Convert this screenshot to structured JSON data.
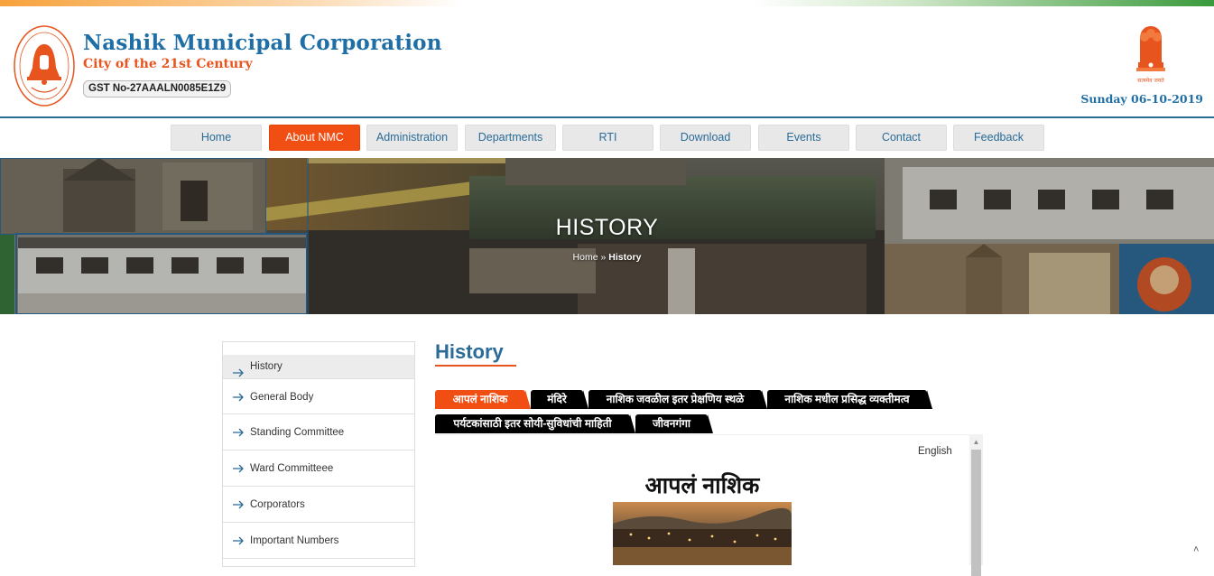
{
  "header": {
    "org_name": "Nashik Municipal Corporation",
    "tagline": "City of the 21st Century",
    "gst": "GST No-27AAALN0085E1Z9",
    "date": "Sunday 06-10-2019",
    "emblem_motto": "सत्यमेव जयते"
  },
  "nav": {
    "items": [
      {
        "label": "Home"
      },
      {
        "label": "About NMC",
        "active": true
      },
      {
        "label": "Administration"
      },
      {
        "label": "Departments"
      },
      {
        "label": "RTI"
      },
      {
        "label": "Download"
      },
      {
        "label": "Events"
      },
      {
        "label": "Contact"
      },
      {
        "label": "Feedback"
      }
    ]
  },
  "banner": {
    "title": "HISTORY",
    "breadcrumb_home": "Home",
    "breadcrumb_sep": " » ",
    "breadcrumb_current": "History"
  },
  "sidebar": {
    "items": [
      {
        "label": "History",
        "active": true
      },
      {
        "label": "General Body"
      },
      {
        "label": "Standing Committee"
      },
      {
        "label": "Ward Committeee"
      },
      {
        "label": "Corporators"
      },
      {
        "label": "Important Numbers"
      }
    ]
  },
  "main": {
    "title": "History",
    "tabs": [
      {
        "label": "आपलं नाशिक",
        "active": true
      },
      {
        "label": "मंदिरे"
      },
      {
        "label": "नाशिक जवळील इतर प्रेक्षणिय स्थळे"
      },
      {
        "label": "नाशिक मधील प्रसिद्ध व्यक्तीमत्व"
      },
      {
        "label": "पर्यटकांसाठी इतर सोयी-सुविधांची माहिती"
      },
      {
        "label": "जीवनगंगा"
      }
    ],
    "content": {
      "lang_link": "English",
      "heading": "आपलं नाशिक"
    }
  },
  "colors": {
    "brand_blue": "#1f6fa6",
    "accent_orange": "#f04e12",
    "tab_black": "#000000"
  }
}
